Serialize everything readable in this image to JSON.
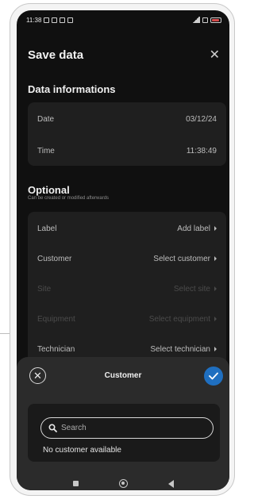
{
  "statusbar": {
    "time": "11:38"
  },
  "header": {
    "title": "Save data"
  },
  "data_informations": {
    "title": "Data informations",
    "rows": [
      {
        "label": "Date",
        "value": "03/12/24"
      },
      {
        "label": "Time",
        "value": "11:38:49"
      }
    ]
  },
  "optional": {
    "title": "Optional",
    "subtitle": "Can be created or modified afterwards",
    "rows": [
      {
        "label": "Label",
        "value": "Add label",
        "enabled": true
      },
      {
        "label": "Customer",
        "value": "Select customer",
        "enabled": true
      },
      {
        "label": "Site",
        "value": "Select site",
        "enabled": false
      },
      {
        "label": "Equipment",
        "value": "Select equipment",
        "enabled": false
      },
      {
        "label": "Technician",
        "value": "Select technician",
        "enabled": true
      }
    ]
  },
  "sheet": {
    "title": "Customer",
    "search_placeholder": "Search",
    "empty_text": "No customer available",
    "confirm_color": "#1f6fc0"
  },
  "icons": {
    "close": "close-icon",
    "check": "check-icon",
    "search": "search-icon",
    "chevron": "chevron-right-icon"
  }
}
